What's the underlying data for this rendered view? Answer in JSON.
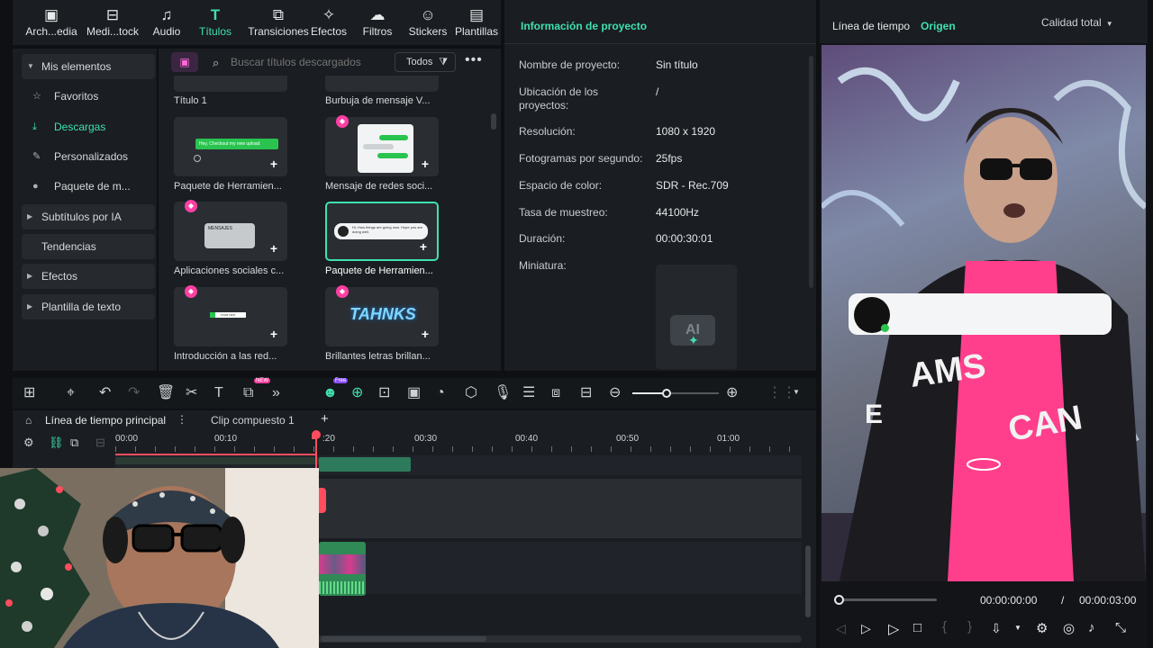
{
  "toolbar": {
    "items": [
      {
        "label": "Arch...edia",
        "icon": "media-icon"
      },
      {
        "label": "Medi...tock",
        "icon": "stock-icon"
      },
      {
        "label": "Audio",
        "icon": "music-icon"
      },
      {
        "label": "Títulos",
        "icon": "title-icon"
      },
      {
        "label": "Transiciones",
        "icon": "transition-icon"
      },
      {
        "label": "Efectos",
        "icon": "effects-icon"
      },
      {
        "label": "Filtros",
        "icon": "filter-icon"
      },
      {
        "label": "Stickers",
        "icon": "sticker-icon"
      },
      {
        "label": "Plantillas",
        "icon": "template-icon"
      }
    ]
  },
  "sidebar": {
    "items": [
      {
        "label": "Mis elementos"
      },
      {
        "label": "Favoritos"
      },
      {
        "label": "Descargas"
      },
      {
        "label": "Personalizados"
      },
      {
        "label": "Paquete de m..."
      },
      {
        "label": "Subtítulos por IA"
      },
      {
        "label": "Tendencias"
      },
      {
        "label": "Efectos"
      },
      {
        "label": "Plantilla de texto"
      }
    ]
  },
  "library": {
    "search_placeholder": "Buscar títulos descargados",
    "filter_label": "Todos",
    "items": [
      {
        "label": "Título 1"
      },
      {
        "label": "Burbuja de mensaje V..."
      },
      {
        "label": "Paquete de Herramien..."
      },
      {
        "label": "Mensaje de redes soci..."
      },
      {
        "label": "Aplicaciones sociales c..."
      },
      {
        "label": "Paquete de Herramien..."
      },
      {
        "label": "Introducción a las red..."
      },
      {
        "label": "Brillantes letras brillan..."
      }
    ],
    "thumb_texts": {
      "t1": "Hey, Checkout my new upload",
      "t3": "MENSAJES",
      "t4": "Hi, How things are going now. Hope you are doing well.",
      "t5": "YOUR TEXT",
      "t6": "TAHNKS"
    }
  },
  "info": {
    "title": "Información de proyecto",
    "rows": [
      {
        "label": "Nombre de proyecto:",
        "value": "Sin título"
      },
      {
        "label": "Ubicación de los",
        "label2": "proyectos:",
        "value": "/"
      },
      {
        "label": "Resolución:",
        "value": "1080 x 1920"
      },
      {
        "label": "Fotogramas por segundo:",
        "value": "25fps"
      },
      {
        "label": "Espacio de color:",
        "value": "SDR - Rec.709"
      },
      {
        "label": "Tasa de muestreo:",
        "value": "44100Hz"
      },
      {
        "label": "Duración:",
        "value": "00:00:30:01"
      },
      {
        "label": "Miniatura:",
        "value": ""
      }
    ]
  },
  "preview": {
    "tab_timeline": "Línea de tiempo",
    "tab_source": "Origen",
    "quality": "Calidad total",
    "time_current": "00:00:00:00",
    "time_sep": "/",
    "time_total": "00:00:03:00",
    "progress": 0.0
  },
  "timeline": {
    "tab_main": "Línea de tiempo principal",
    "tab_compound": "Clip compuesto 1",
    "badge_new": "NEW",
    "badge_free": "Free",
    "ticks": [
      "00:00",
      "00:10",
      ":20",
      "00:30",
      "00:40",
      "00:50",
      "01:00"
    ]
  },
  "colors": {
    "accent": "#3fe0b0",
    "gem": "#ff3fa3",
    "playhead": "#ff4d5e"
  }
}
